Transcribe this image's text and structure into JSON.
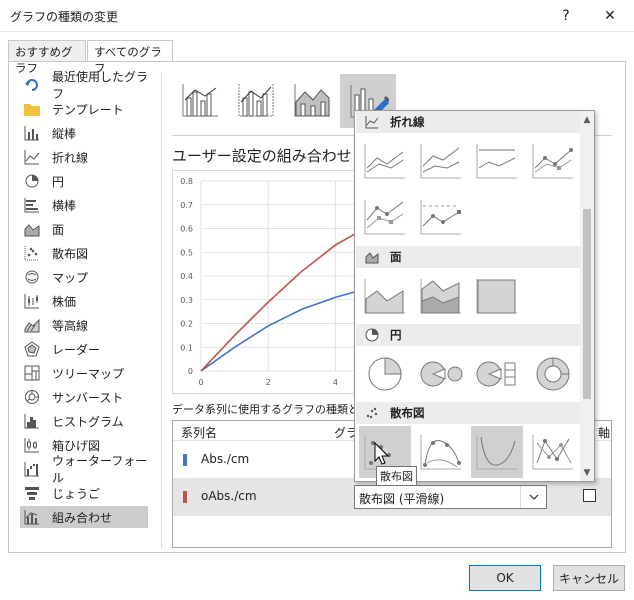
{
  "window": {
    "title": "グラフの種類の変更",
    "help": "?",
    "close": "✕"
  },
  "tabs": [
    {
      "label": "おすすめグラフ"
    },
    {
      "label": "すべてのグラフ"
    }
  ],
  "sidebar": {
    "items": [
      {
        "label": "最近使用したグラフ",
        "icon": "recent-icon"
      },
      {
        "label": "テンプレート",
        "icon": "folder-icon"
      },
      {
        "label": "縦棒",
        "icon": "column-chart-icon"
      },
      {
        "label": "折れ線",
        "icon": "line-chart-icon"
      },
      {
        "label": "円",
        "icon": "pie-chart-icon"
      },
      {
        "label": "横棒",
        "icon": "bar-chart-icon"
      },
      {
        "label": "面",
        "icon": "area-chart-icon"
      },
      {
        "label": "散布図",
        "icon": "scatter-chart-icon"
      },
      {
        "label": "マップ",
        "icon": "map-chart-icon"
      },
      {
        "label": "株価",
        "icon": "stock-chart-icon"
      },
      {
        "label": "等高線",
        "icon": "surface-chart-icon"
      },
      {
        "label": "レーダー",
        "icon": "radar-chart-icon"
      },
      {
        "label": "ツリーマップ",
        "icon": "treemap-chart-icon"
      },
      {
        "label": "サンバースト",
        "icon": "sunburst-chart-icon"
      },
      {
        "label": "ヒストグラム",
        "icon": "histogram-chart-icon"
      },
      {
        "label": "箱ひげ図",
        "icon": "boxwhisker-chart-icon"
      },
      {
        "label": "ウォーターフォール",
        "icon": "waterfall-chart-icon"
      },
      {
        "label": "じょうご",
        "icon": "funnel-chart-icon"
      },
      {
        "label": "組み合わせ",
        "icon": "combo-chart-icon"
      }
    ],
    "selected_index": 18
  },
  "preview": {
    "title": "ユーザー設定の組み合わせ"
  },
  "chart_data": {
    "type": "line",
    "title": "",
    "xlabel": "",
    "ylabel": "",
    "xlim": [
      0,
      5
    ],
    "ylim": [
      0,
      0.8
    ],
    "x_ticks": [
      "0",
      "2",
      "4"
    ],
    "y_ticks": [
      "0",
      "0.1",
      "0.2",
      "0.3",
      "0.4",
      "0.5",
      "0.6",
      "0.7",
      "0.8"
    ],
    "grid": true,
    "series": [
      {
        "name": "Abs./cm",
        "color": "#4472c4",
        "x": [
          0,
          1,
          2,
          3,
          4,
          5
        ],
        "y": [
          0,
          0.1,
          0.19,
          0.26,
          0.31,
          0.35
        ]
      },
      {
        "name": "oAbs./cm",
        "color": "#c0504d",
        "x": [
          0,
          1,
          2,
          3,
          4,
          5
        ],
        "y": [
          0,
          0.15,
          0.29,
          0.42,
          0.53,
          0.61
        ]
      }
    ]
  },
  "series_table": {
    "label": "データ系列に使用するグラフの種類と軸",
    "col_name": "系列名",
    "col_type": "グラ",
    "col_axis": "軸",
    "rows": [
      {
        "name": "Abs./cm",
        "color": "#4472c4",
        "type": ""
      },
      {
        "name": "oAbs./cm",
        "color": "#c0504d",
        "type": "散布図 (平滑線)"
      }
    ]
  },
  "dropdown": {
    "sections": [
      {
        "label": "折れ線",
        "icon": "line-chart-icon"
      },
      {
        "label": "面",
        "icon": "area-chart-icon"
      },
      {
        "label": "円",
        "icon": "pie-chart-icon"
      },
      {
        "label": "散布図",
        "icon": "scatter-chart-icon"
      }
    ],
    "tooltip": "散布図"
  },
  "buttons": {
    "ok": "OK",
    "cancel": "キャンセル"
  }
}
